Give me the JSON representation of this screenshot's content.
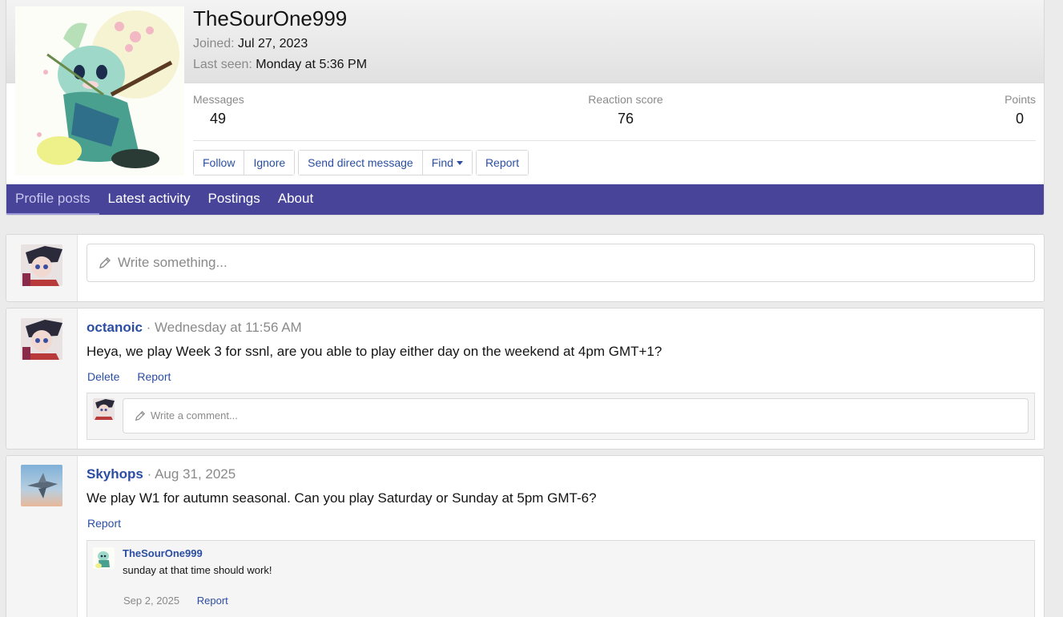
{
  "profile": {
    "username": "TheSourOne999",
    "joined_label": "Joined:",
    "joined_value": "Jul 27, 2023",
    "last_seen_label": "Last seen:",
    "last_seen_value": "Monday at 5:36 PM",
    "stats": {
      "messages_label": "Messages",
      "messages_value": "49",
      "reaction_label": "Reaction score",
      "reaction_value": "76",
      "points_label": "Points",
      "points_value": "0"
    },
    "buttons": {
      "follow": "Follow",
      "ignore": "Ignore",
      "send_dm": "Send direct message",
      "find": "Find",
      "report": "Report"
    }
  },
  "tabs": [
    "Profile posts",
    "Latest activity",
    "Postings",
    "About"
  ],
  "composer": {
    "placeholder": "Write something..."
  },
  "posts": [
    {
      "author": "octanoic",
      "separator": "·",
      "time": "Wednesday at 11:56 AM",
      "body": "Heya, we play Week 3 for ssnl, are you able to play either day on the weekend at 4pm GMT+1?",
      "actions": [
        "Delete",
        "Report"
      ],
      "comment_placeholder": "Write a comment..."
    },
    {
      "author": "Skyhops",
      "separator": "·",
      "time": "Aug 31, 2025",
      "body": "We play W1 for autumn seasonal. Can you play Saturday or Sunday at 5pm GMT-6?",
      "actions": [
        "Report"
      ],
      "reply": {
        "author": "TheSourOne999",
        "text": "sunday at that time should work!",
        "date": "Sep 2, 2025",
        "report": "Report"
      }
    }
  ]
}
